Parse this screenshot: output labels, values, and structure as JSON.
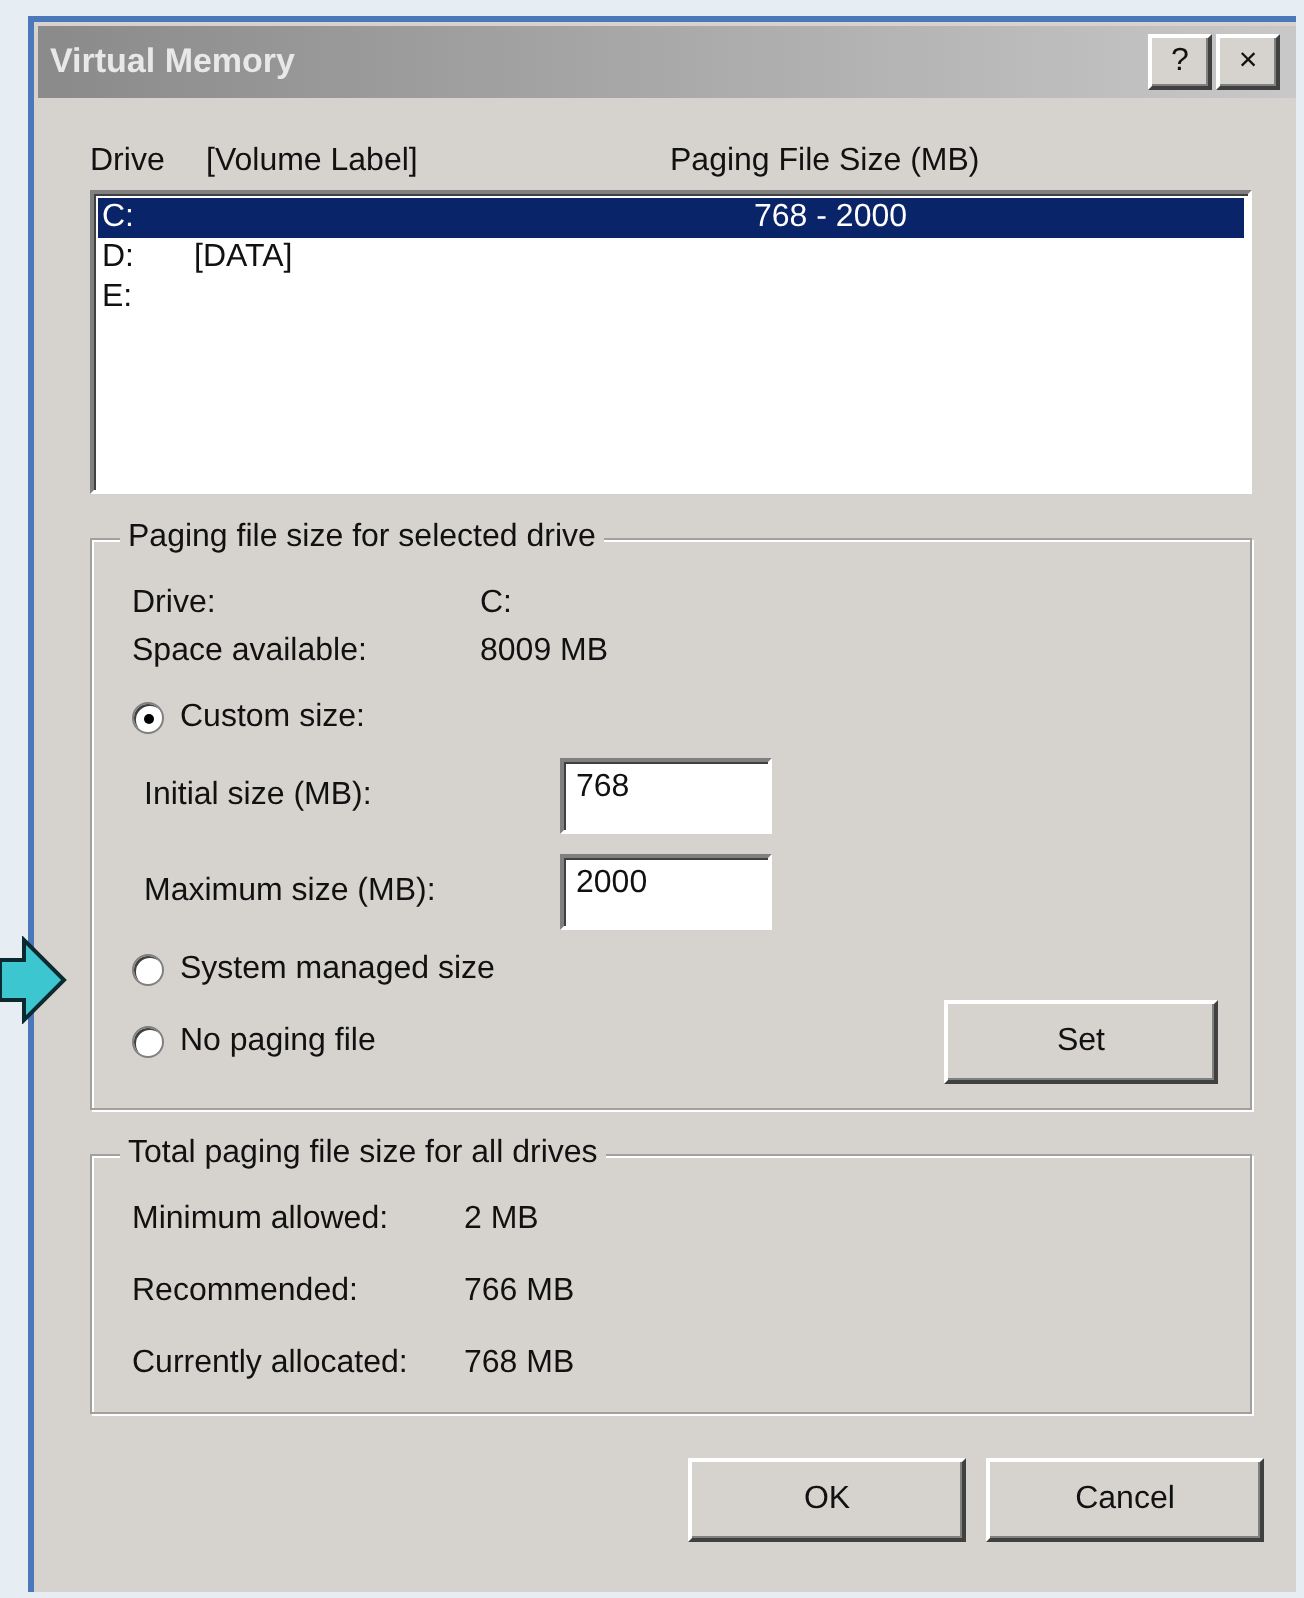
{
  "window": {
    "title": "Virtual Memory",
    "help_button": "?",
    "close_button": "×"
  },
  "drive_list": {
    "columns": [
      "Drive",
      "[Volume Label]",
      "Paging File Size (MB)"
    ],
    "rows": [
      {
        "drive": "C:",
        "size": "768 - 2000",
        "selected": true
      },
      {
        "drive": "D:",
        "label": "[DATA]",
        "selected": false
      },
      {
        "drive": "E:",
        "selected": false
      }
    ]
  },
  "selected_drive_group": {
    "title": "Paging file size for selected drive",
    "info": [
      {
        "label": "Drive:",
        "value": "C:"
      },
      {
        "label": "Space available:",
        "value": "8009 MB"
      }
    ],
    "options": [
      {
        "label": "Custom size:",
        "selected": true,
        "fields": [
          {
            "label": "Initial size (MB):",
            "value": "768"
          },
          {
            "label": "Maximum size (MB):",
            "value": "2000"
          }
        ]
      },
      {
        "label": "System managed size",
        "selected": false
      },
      {
        "label": "No paging file",
        "selected": false
      }
    ],
    "set_button": "Set"
  },
  "total_group": {
    "title": "Total paging file size for all drives",
    "info": [
      {
        "label": "Minimum allowed:",
        "value": "2 MB"
      },
      {
        "label": "Recommended:",
        "value": "766 MB"
      },
      {
        "label": "Currently allocated:",
        "value": "768 MB"
      }
    ]
  },
  "buttons": [
    "OK",
    "Cancel"
  ]
}
